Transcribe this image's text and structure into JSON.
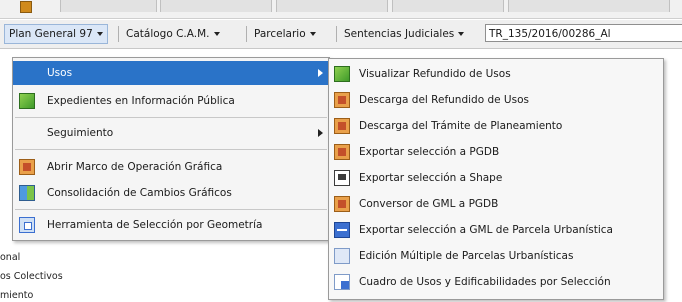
{
  "menubar": {
    "items": [
      {
        "label": "Plan General 97"
      },
      {
        "label": "Catálogo C.A.M."
      },
      {
        "label": "Parcelario"
      },
      {
        "label": "Sentencias Judiciales"
      }
    ],
    "expediente_value": "TR_135/2016/00286_Al"
  },
  "main_menu": {
    "items": [
      {
        "label": "Usos",
        "icon": "none",
        "has_submenu": true,
        "highlighted": true
      },
      {
        "label": "Expedientes en Información Pública",
        "icon": "green-map-icon"
      },
      {
        "label": "Seguimiento",
        "icon": "none",
        "has_submenu": true
      },
      {
        "label": "Abrir Marco de Operación Gráfica",
        "icon": "orange-frame-icon"
      },
      {
        "label": "Consolidación de Cambios Gráficos",
        "icon": "consolidation-icon"
      },
      {
        "label": "Herramienta de Selección por Geometría",
        "icon": "selection-tool-icon"
      }
    ]
  },
  "submenu": {
    "items": [
      {
        "label": "Visualizar Refundido de Usos",
        "icon": "green-map-icon"
      },
      {
        "label": "Descarga del Refundido de Usos",
        "icon": "orange-download-icon"
      },
      {
        "label": "Descarga del Trámite de Planeamiento",
        "icon": "orange-download-icon"
      },
      {
        "label": "Exportar selección a PGDB",
        "icon": "orange-export-icon"
      },
      {
        "label": "Exportar selección a Shape",
        "icon": "shape-export-icon"
      },
      {
        "label": "Conversor de GML a PGDB",
        "icon": "orange-convert-icon"
      },
      {
        "label": "Exportar selección a GML de Parcela Urbanística",
        "icon": "blue-export-icon"
      },
      {
        "label": "Edición Múltiple de Parcelas Urbanísticas",
        "icon": "multi-edit-icon"
      },
      {
        "label": "Cuadro de Usos y Edificabilidades por Selección",
        "icon": "table-icon"
      }
    ]
  },
  "background_tree": {
    "items": [
      "onal",
      "os Colectivos",
      "miento"
    ]
  },
  "colors": {
    "highlight": "#2a73c8",
    "menu_bg": "#f5f5f5"
  }
}
